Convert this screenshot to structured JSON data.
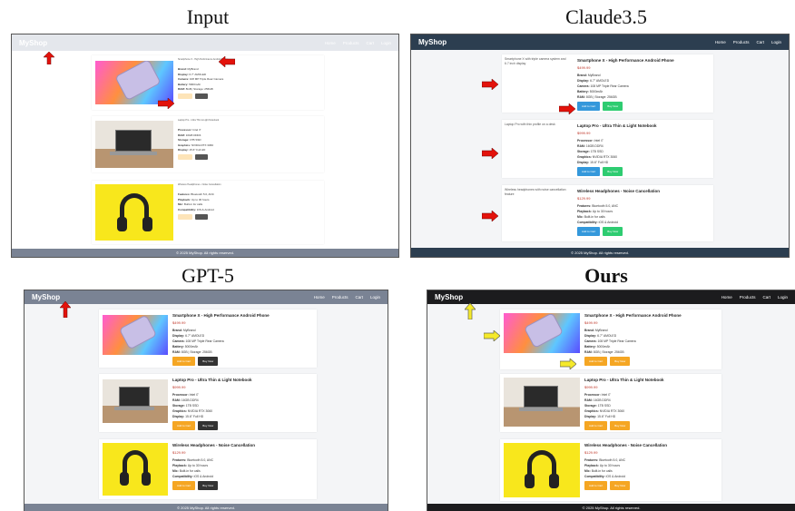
{
  "labels": {
    "input": "Input",
    "claude": "Claude3.5",
    "gpt": "GPT-5",
    "ours": "Ours"
  },
  "shop": {
    "brand": "MyShop",
    "nav": [
      "Home",
      "Products",
      "Cart",
      "Login"
    ],
    "footer": "© 2025 MyShop. All rights reserved.",
    "add_cart": "Add to Cart",
    "buy_now": "Buy Now",
    "products": [
      {
        "title": "Smartphone X - High Performance Android Phone",
        "price": "$499.99",
        "specs": [
          [
            "Brand:",
            "MyBrand"
          ],
          [
            "Display:",
            "6.7\" AMOLED"
          ],
          [
            "Camera:",
            "108 MP Triple Rear Camera"
          ],
          [
            "Battery:",
            "5000mAh"
          ],
          [
            "RAM:",
            "8GB | Storage: 256GB"
          ]
        ],
        "alt": "Smartphone X with triple camera system and 6.7 inch display"
      },
      {
        "title": "Laptop Pro - Ultra Thin & Light Notebook",
        "price": "$999.99",
        "specs": [
          [
            "Processor:",
            "Intel i7"
          ],
          [
            "RAM:",
            "16GB DDR4"
          ],
          [
            "Storage:",
            "1TB SSD"
          ],
          [
            "Graphics:",
            "NVIDIA RTX 3060"
          ],
          [
            "Display:",
            "15.6\" Full HD"
          ]
        ],
        "alt": "Laptop Pro with thin profile on a desk"
      },
      {
        "title": "Wireless Headphones - Noise Cancellation",
        "price": "$129.99",
        "specs": [
          [
            "Features:",
            "Bluetooth 5.0, ANC"
          ],
          [
            "Playback:",
            "Up to 30 hours"
          ],
          [
            "Mic:",
            "Built-in for calls"
          ],
          [
            "Compatibility:",
            "iOS & Android"
          ]
        ],
        "alt": "Wireless headphones with noise cancellation feature"
      }
    ]
  },
  "colors": {
    "arrow_red": "#e3120b",
    "arrow_yellow": "#f5e92a",
    "nav_gray": "#7a8394",
    "nav_dark": "#2c3e50",
    "nav_black": "#1c1c1e",
    "orange": "#f5a623",
    "dark_btn": "#333333",
    "blue": "#3498db",
    "green": "#2ecc71"
  }
}
